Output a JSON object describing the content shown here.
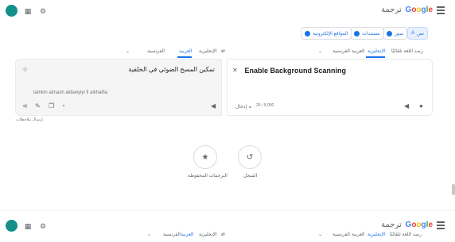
{
  "header": {
    "brand": "Google",
    "product": "ترجمة",
    "menu_icon": "menu-icon",
    "apps_icon": "apps-grid-icon",
    "settings_icon": "gear-icon"
  },
  "modes": {
    "text": "نص",
    "images": "صور",
    "documents": "مستندات",
    "websites": "المواقع الإلكترونية"
  },
  "source_langs": [
    "رصد اللغة تلقائيًا",
    "الإنجليزية",
    "العربية",
    "الفرنسية"
  ],
  "target_langs": [
    "العربية",
    "الإنجليزية",
    "الفرنسية"
  ],
  "source": {
    "text": "Enable Background Scanning",
    "count": "26 / 5,000",
    "keyboard_label": "إدخال"
  },
  "target": {
    "text": "تمكين المسح الضوئي في الخلفية",
    "translit": "tamkin almash aldawyiyi fi alkhalfia"
  },
  "feedback": "إرسال ملاحظات",
  "history": {
    "label": "السجل"
  },
  "saved": {
    "label": "الترجمات المحفوظة"
  }
}
